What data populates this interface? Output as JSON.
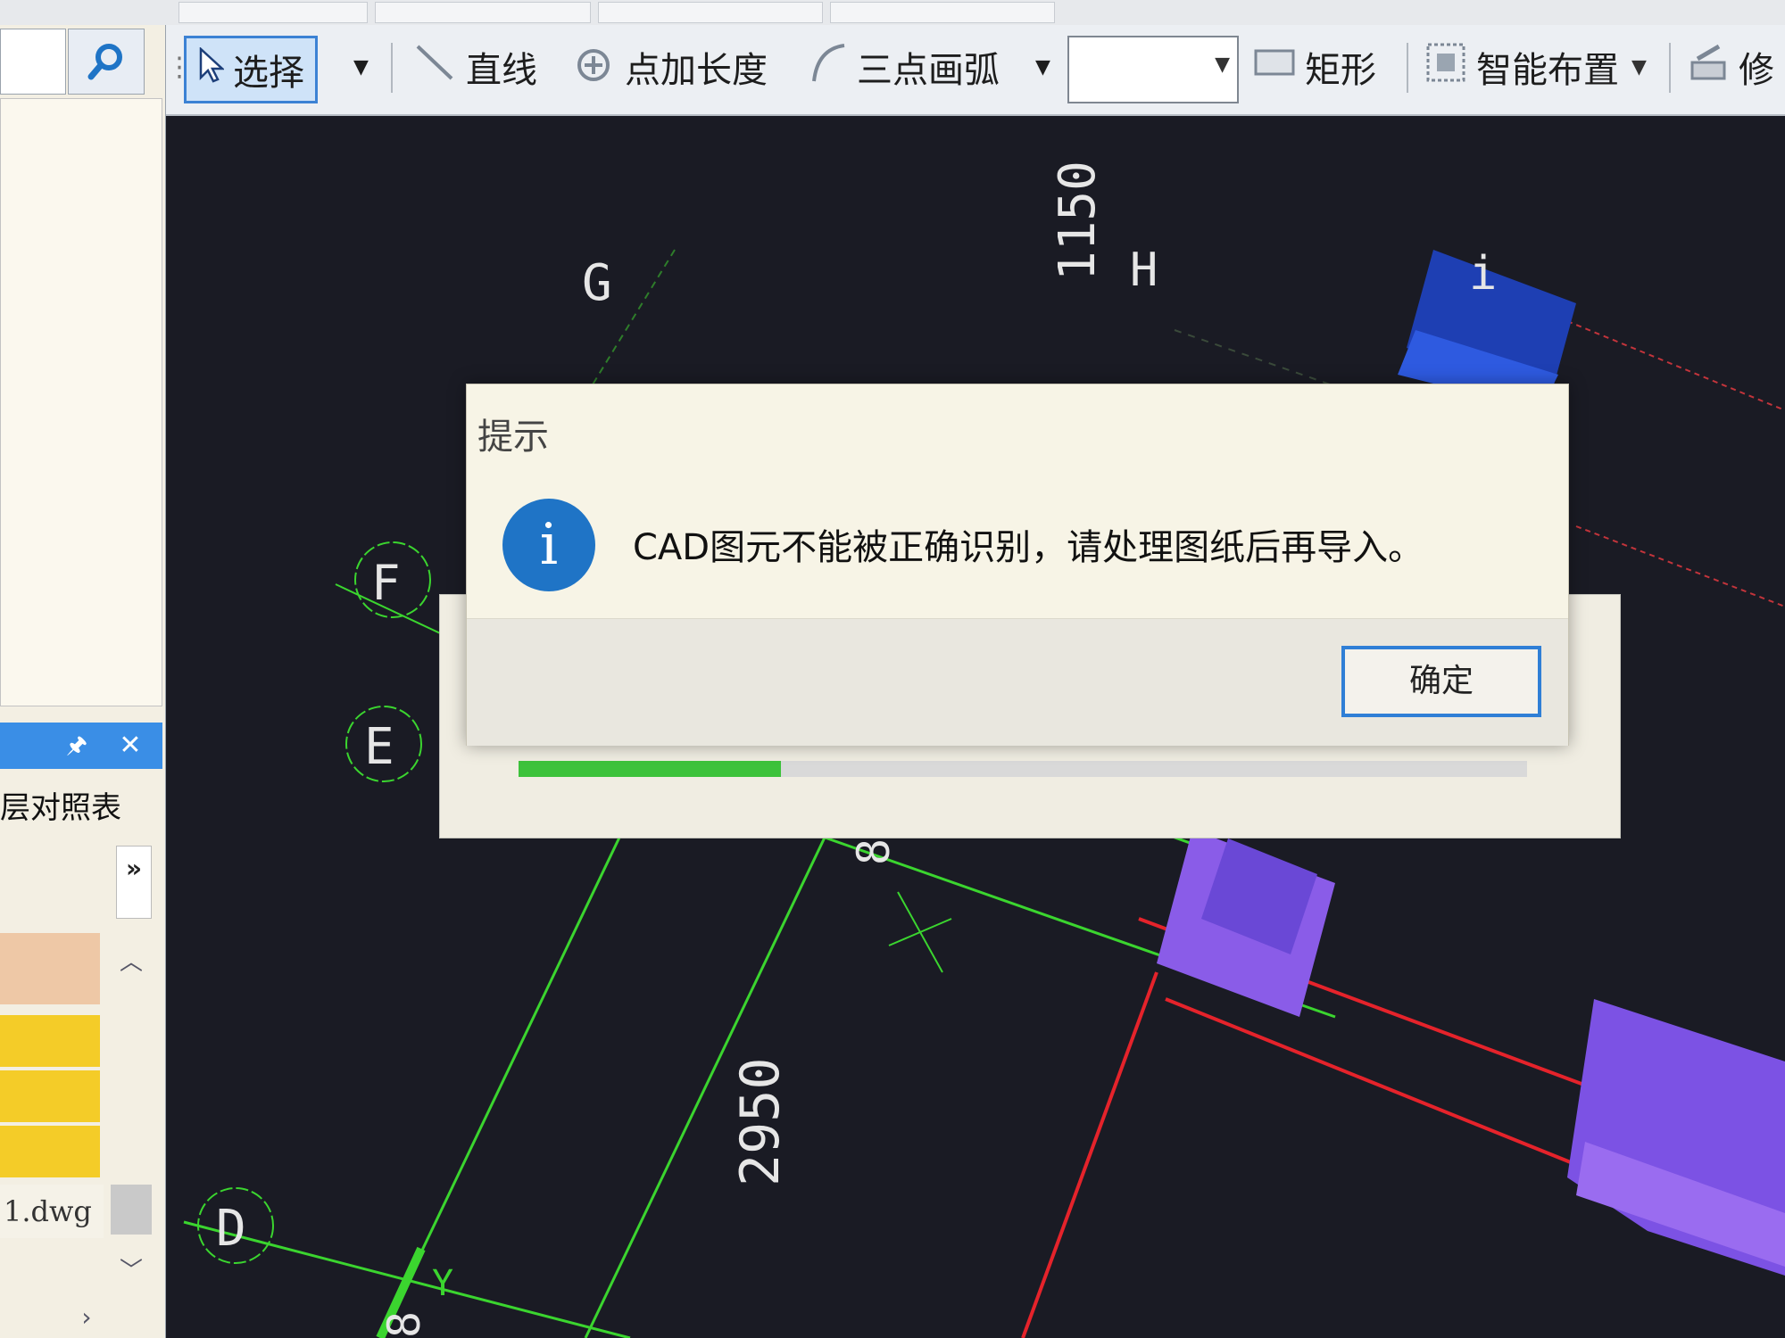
{
  "toolbar": {
    "select_label": "选择",
    "line_label": "直线",
    "point_length_label": "点加长度",
    "three_point_arc_label": "三点画弧",
    "rect_label": "矩形",
    "smart_layout_label": "智能布置",
    "modify_label": "修",
    "combo_value": ""
  },
  "left_panel": {
    "title": "层对照表",
    "expand_label": "»",
    "file_name": "1.dwg"
  },
  "canvas": {
    "axis_labels": [
      "G",
      "H",
      "i",
      "F",
      "E",
      "D"
    ],
    "dimensions": [
      "1150",
      "2950",
      "8",
      "8"
    ],
    "ucs_label": "Y"
  },
  "dialog": {
    "title": "提示",
    "message": "CAD图元不能被正确识别，请处理图纸后再导入。",
    "ok_label": "确定"
  },
  "progress": {
    "fraction": 0.26
  },
  "colors": {
    "accent": "#3c82d4",
    "grid_green": "#3bd52f",
    "wall_red": "#e5232b",
    "column_purple": "#8a5ce8",
    "info_blue": "#1f74c6",
    "progress_green": "#3dc23b"
  }
}
